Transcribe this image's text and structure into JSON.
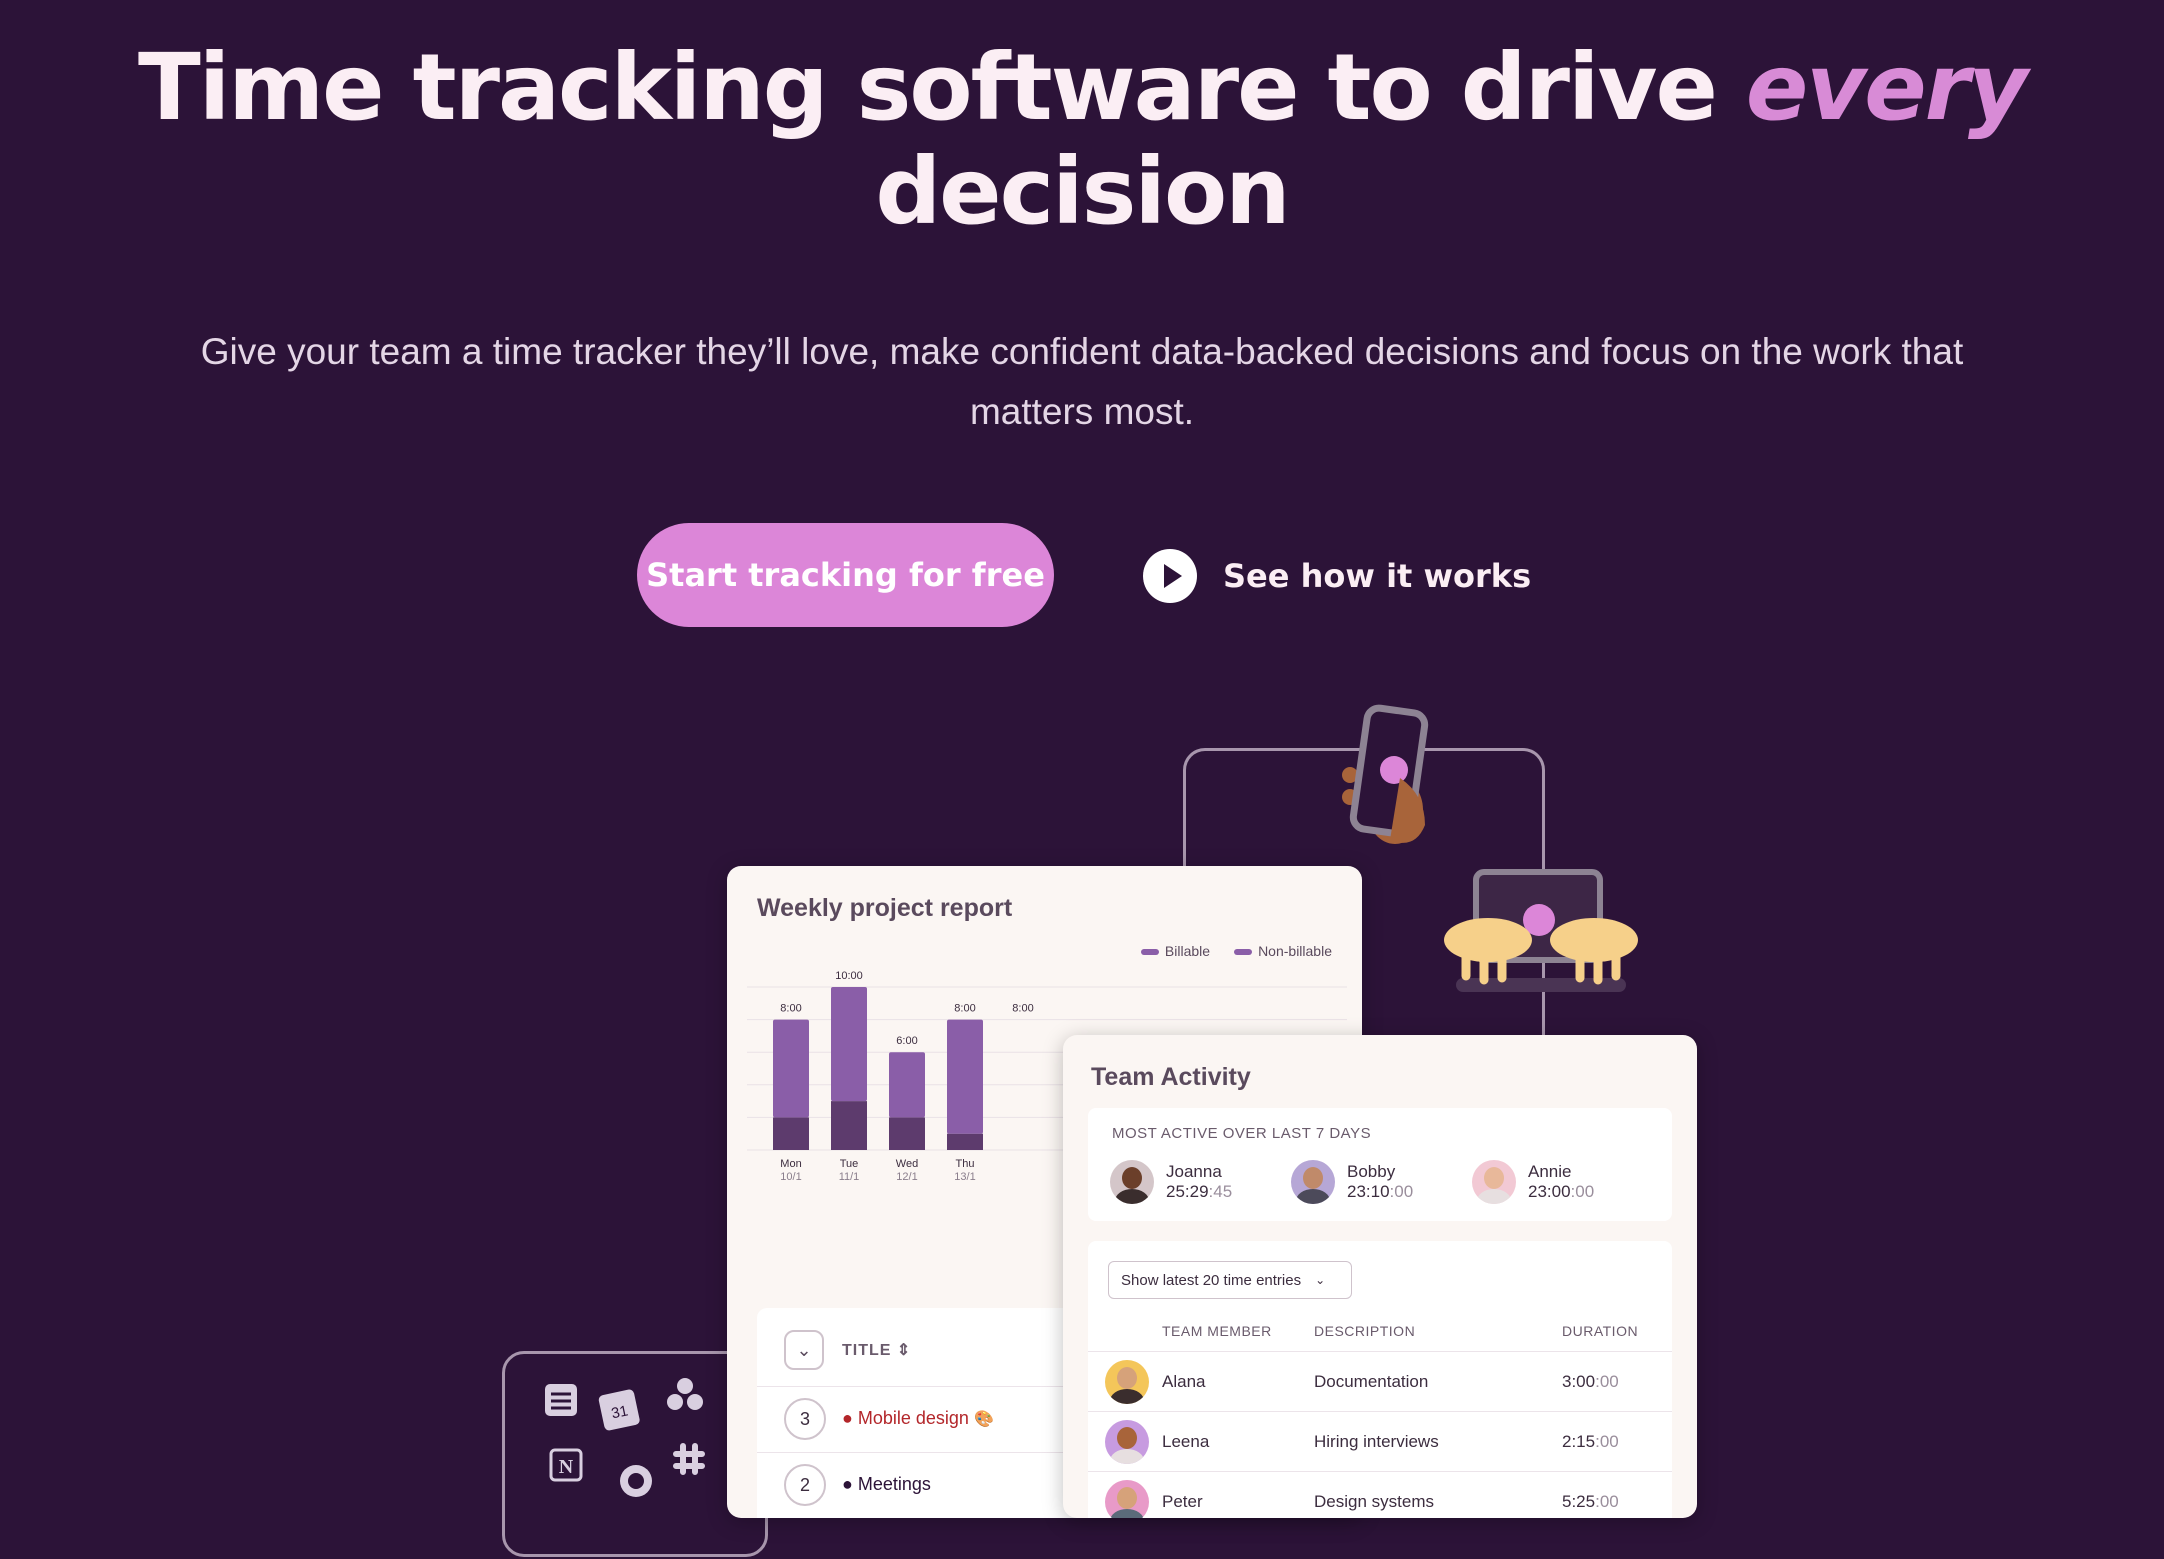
{
  "hero": {
    "title_main": "Time tracking software to drive ",
    "title_accent": "every",
    "title_end": "decision",
    "subtitle": "Give your team a time tracker they’ll love, make confident data-backed decisions and focus on the work that matters most.",
    "cta_label": "Start tracking for free",
    "video_label": "See how it works"
  },
  "colors": {
    "background": "#2c1338",
    "accent": "#dc86d8",
    "billable": "#8a5ea8",
    "non_billable": "#5d3b6d"
  },
  "weekly_report": {
    "title": "Weekly project report",
    "legend": [
      "Billable",
      "Non-billable"
    ],
    "table_header": "TITLE",
    "rows": [
      {
        "count": "3",
        "label": "Mobile design",
        "color": "#b3262a",
        "icon": "palette-icon"
      },
      {
        "count": "2",
        "label": "Meetings",
        "color": "#2c1338"
      }
    ]
  },
  "chart_data": {
    "type": "bar",
    "stacked": true,
    "categories": [
      "Mon",
      "Tue",
      "Wed",
      "Thu"
    ],
    "dates": [
      "10/1",
      "11/1",
      "12/1",
      "13/1"
    ],
    "total_labels": [
      "8:00",
      "10:00",
      "6:00",
      "8:00",
      "8:00"
    ],
    "series": [
      {
        "name": "Billable",
        "values": [
          6,
          7,
          4,
          7
        ]
      },
      {
        "name": "Non-billable",
        "values": [
          2,
          3,
          2,
          1
        ]
      }
    ],
    "ylim": [
      0,
      10
    ],
    "grid": true
  },
  "team_activity": {
    "title": "Team Activity",
    "active_heading": "MOST ACTIVE OVER LAST 7 DAYS",
    "members": [
      {
        "name": "Joanna",
        "time": "25:29",
        "secs": ":45"
      },
      {
        "name": "Bobby",
        "time": "23:10",
        "secs": ":00"
      },
      {
        "name": "Annie",
        "time": "23:00",
        "secs": ":00"
      }
    ],
    "select_label": "Show latest 20 time entries",
    "columns": [
      "TEAM MEMBER",
      "DESCRIPTION",
      "DURATION"
    ],
    "entries": [
      {
        "member": "Alana",
        "description": "Documentation",
        "duration": "3:00",
        "secs": ":00"
      },
      {
        "member": "Leena",
        "description": "Hiring interviews",
        "duration": "2:15",
        "secs": ":00"
      },
      {
        "member": "Peter",
        "description": "Design systems",
        "duration": "5:25",
        "secs": ":00"
      }
    ]
  },
  "integrations": {
    "calendar_day": "31",
    "icons": [
      "todoist-icon",
      "calendar-icon",
      "asana-icon",
      "notion-icon",
      "github-icon",
      "slack-icon"
    ]
  }
}
